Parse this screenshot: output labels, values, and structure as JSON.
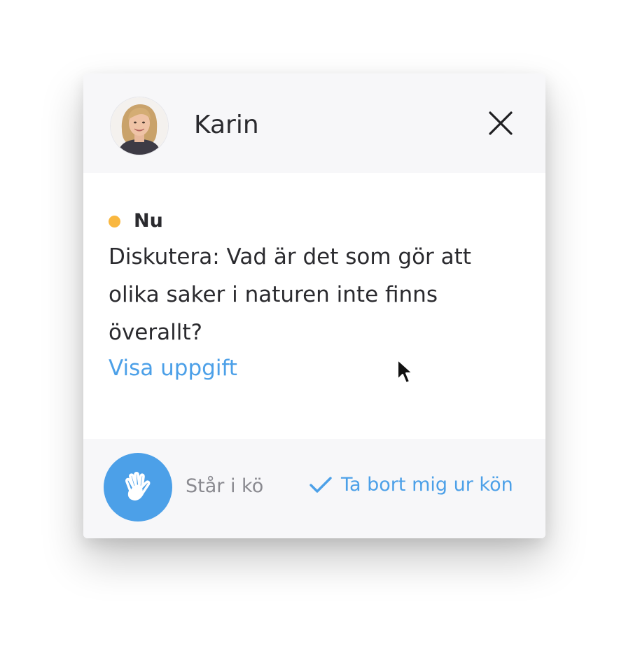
{
  "header": {
    "name": "Karin",
    "avatar_icon": "user-photo",
    "close_icon": "close-icon"
  },
  "status": {
    "label": "Nu",
    "dot_color": "#f9b73f"
  },
  "message": {
    "text": "Diskutera: Vad är det som gör att olika saker i naturen inte finns överallt?",
    "link_label": "Visa uppgift"
  },
  "footer": {
    "hand_icon": "raise-hand-icon",
    "queue_status": "Står i kö",
    "remove_label": "Ta bort mig ur kön",
    "check_icon": "check-icon"
  },
  "colors": {
    "accent": "#4ca0e8",
    "panel_bg": "#f7f7f9",
    "text": "#2a2a2e",
    "muted": "#8a8a90"
  }
}
